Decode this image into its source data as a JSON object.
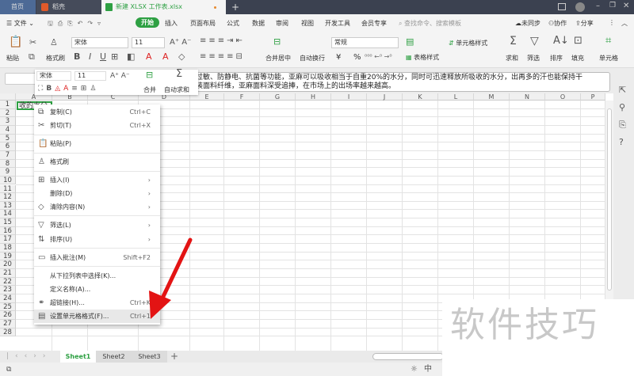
{
  "tabs": {
    "home": "首页",
    "docer": "稻壳",
    "file": "新建 XLSX 工作表.xlsx",
    "new_tab": "+"
  },
  "menu": {
    "file": "文件",
    "items": [
      "开始",
      "插入",
      "页面布局",
      "公式",
      "数据",
      "审阅",
      "视图",
      "开发工具",
      "会员专享"
    ],
    "search_placeholder": "查找命令、搜索模板",
    "sync": "未同步",
    "collab": "协作",
    "share": "分享"
  },
  "ribbon": {
    "paste": "粘贴",
    "format_painter": "格式刷",
    "font": "宋体",
    "size": "11",
    "merge_center": "合并居中",
    "wrap": "自动换行",
    "number_format": "常规",
    "currency": "¥",
    "percent": "%",
    "table_style": "表格样式",
    "cell_style": "单元格样式",
    "sum": "求和",
    "filter": "筛选",
    "sort": "排序",
    "fill": "填充",
    "cell": "单元格"
  },
  "mini_toolbar": {
    "font": "宋体",
    "size": "11",
    "merge": "合并",
    "autosum": "自动求和"
  },
  "formula": {
    "line1": "过敏、防静电、抗菌等功能，亚麻可以吸收相当于自重20%的水分，同时可迅速释放所吸收的水分，出再多的汗也能保持干",
    "line2": "装面料纤维，亚麻面料深受追捧，在市场上的出场率越来越高。"
  },
  "grid": {
    "columns": [
      "A",
      "B",
      "C",
      "D",
      "E",
      "F",
      "G",
      "H",
      "I",
      "J",
      "K",
      "L",
      "M",
      "N",
      "O",
      "P"
    ],
    "rows": [
      "1",
      "2",
      "3",
      "4",
      "5",
      "6",
      "7",
      "8",
      "9",
      "10",
      "11",
      "12",
      "13",
      "14",
      "15",
      "16",
      "17",
      "18",
      "19",
      "20",
      "21",
      "22",
      "23",
      "24",
      "25",
      "26",
      "27",
      "28"
    ],
    "cell_a1": "收的水分"
  },
  "context_menu": [
    {
      "label": "复制(C)",
      "shortcut": "Ctrl+C",
      "icon": "copy-icon"
    },
    {
      "label": "剪切(T)",
      "shortcut": "Ctrl+X",
      "icon": "cut-icon"
    },
    {
      "label": "粘贴(P)",
      "shortcut": "",
      "icon": "paste-icon"
    },
    {
      "label": "格式刷",
      "shortcut": "",
      "icon": "format-painter-icon"
    },
    {
      "label": "插入(I)",
      "shortcut": "›",
      "icon": "insert-icon"
    },
    {
      "label": "删除(D)",
      "shortcut": "›",
      "icon": ""
    },
    {
      "label": "清除内容(N)",
      "shortcut": "›",
      "icon": "eraser-icon"
    },
    {
      "label": "筛选(L)",
      "shortcut": "›",
      "icon": "filter-icon"
    },
    {
      "label": "排序(U)",
      "shortcut": "›",
      "icon": "sort-icon"
    },
    {
      "label": "插入批注(M)",
      "shortcut": "Shift+F2",
      "icon": "comment-icon"
    },
    {
      "label": "从下拉列表中选择(K)...",
      "shortcut": "",
      "icon": ""
    },
    {
      "label": "定义名称(A)...",
      "shortcut": "",
      "icon": ""
    },
    {
      "label": "超链接(H)...",
      "shortcut": "Ctrl+K",
      "icon": "link-icon"
    },
    {
      "label": "设置单元格格式(F)...",
      "shortcut": "Ctrl+1",
      "icon": "format-cells-icon"
    }
  ],
  "sheets": [
    "Sheet1",
    "Sheet2",
    "Sheet3"
  ],
  "watermark": "软件技巧",
  "colors": {
    "accent": "#2ea043",
    "tabbar": "#3b4150",
    "arrow": "#e31414"
  }
}
